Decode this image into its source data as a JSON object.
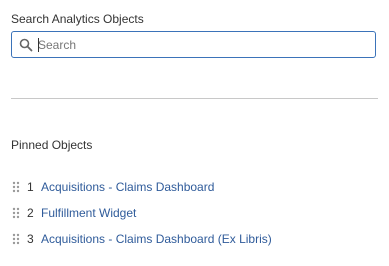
{
  "search": {
    "label": "Search Analytics Objects",
    "placeholder": "Search",
    "value": "",
    "icon": "search-icon"
  },
  "pinned": {
    "heading": "Pinned Objects",
    "items": [
      {
        "index": "1",
        "label": "Acquisitions - Claims Dashboard"
      },
      {
        "index": "2",
        "label": "Fulfillment Widget"
      },
      {
        "index": "3",
        "label": "Acquisitions - Claims Dashboard (Ex Libris)"
      }
    ]
  },
  "colors": {
    "accent_border": "#3b73b9",
    "link": "#2f5b9a",
    "text": "#333333",
    "divider": "#c8c8c8"
  }
}
